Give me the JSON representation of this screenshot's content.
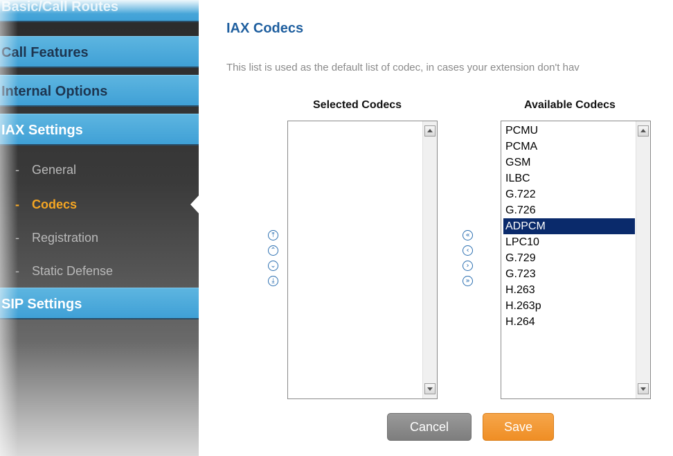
{
  "sidebar": {
    "sections": [
      {
        "label": "Basic/Call Routes"
      },
      {
        "label": "Call Features"
      },
      {
        "label": "Internal Options"
      },
      {
        "label": "IAX Settings"
      },
      {
        "label": "SIP Settings"
      }
    ],
    "sub_items": [
      {
        "label": "General",
        "dash": "-"
      },
      {
        "label": "Codecs",
        "dash": "-"
      },
      {
        "label": "Registration",
        "dash": "-"
      },
      {
        "label": "Static Defense",
        "dash": "-"
      }
    ],
    "active_item": "Codecs"
  },
  "main": {
    "title": "IAX Codecs",
    "description": "This list is used as the default list of codec, in cases your extension don't hav",
    "selected_codecs": {
      "title": "Selected Codecs",
      "items": []
    },
    "available_codecs": {
      "title": "Available Codecs",
      "items": [
        "PCMU",
        "PCMA",
        "GSM",
        "ILBC",
        "G.722",
        "G.726",
        "ADPCM",
        "LPC10",
        "G.729",
        "G.723",
        "H.263",
        "H.263p",
        "H.264"
      ],
      "selected": "ADPCM"
    },
    "order_buttons": [
      {
        "glyph": "⤒",
        "name": "move-top-icon"
      },
      {
        "glyph": "⌃",
        "name": "move-up-icon"
      },
      {
        "glyph": "⌄",
        "name": "move-down-icon"
      },
      {
        "glyph": "⤓",
        "name": "move-bottom-icon"
      }
    ],
    "transfer_buttons": [
      {
        "glyph": "«",
        "name": "move-all-left-icon"
      },
      {
        "glyph": "‹",
        "name": "move-left-icon"
      },
      {
        "glyph": "›",
        "name": "move-right-icon"
      },
      {
        "glyph": "»",
        "name": "move-all-right-icon"
      }
    ],
    "buttons": {
      "cancel": "Cancel",
      "save": "Save"
    }
  },
  "colors": {
    "menu_header": "#3fa0d6",
    "active_item": "#f5a623",
    "title": "#1f5f9f",
    "selection": "#0a2a6b",
    "save_button": "#ef8e25",
    "cancel_button": "#7d7d7d"
  }
}
